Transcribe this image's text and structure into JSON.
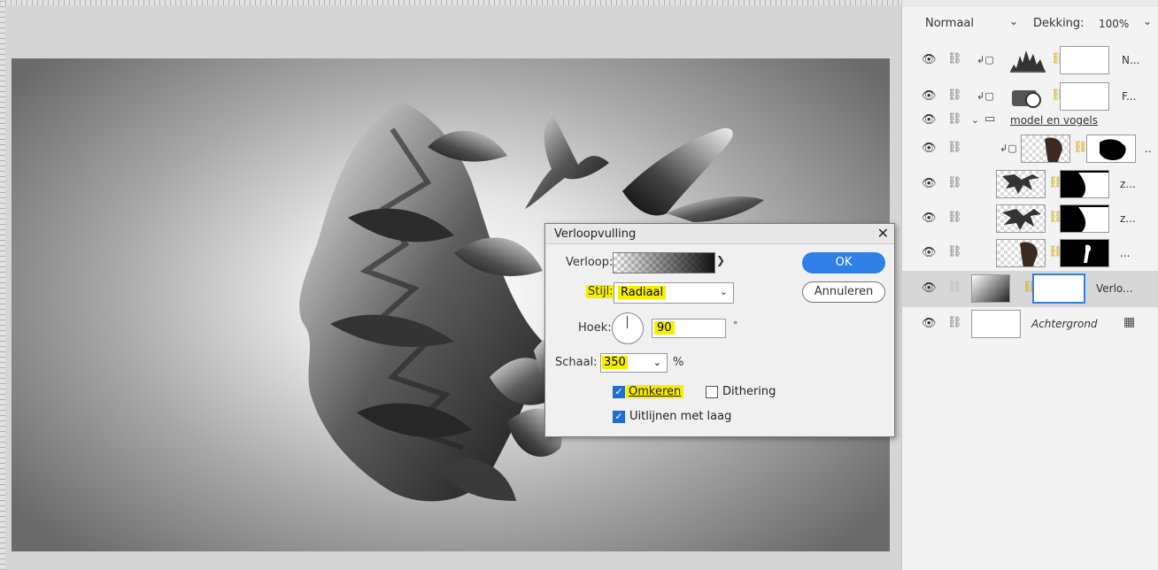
{
  "dialog": {
    "title": "Verloopvulling",
    "close_glyph": "✕",
    "gradient_label": "Verloop:",
    "style_label": "Stijl:",
    "style_value": "Radiaal",
    "angle_label": "Hoek:",
    "angle_value": "90",
    "angle_unit": "°",
    "scale_label": "Schaal:",
    "scale_value": "350",
    "scale_unit": "%",
    "reverse_label": "Omkeren",
    "reverse_checked": true,
    "dither_label": "Dithering",
    "dither_checked": false,
    "align_label": "Uitlijnen met laag",
    "align_checked": true,
    "ok_label": "OK",
    "cancel_label": "Annuleren",
    "highlight_color": "#f7ee00",
    "accent_color": "#2f7fe6"
  },
  "layers": {
    "blend_mode": "Normaal",
    "opacity_label": "Dekking:",
    "opacity_value": "100%",
    "rows": [
      {
        "name": "N...",
        "icon": "histogram-levels-icon"
      },
      {
        "name": "F...",
        "icon": "camera-filter-icon"
      },
      {
        "name": "model en vogels",
        "icon": "folder-group-icon"
      },
      {
        "name": "..",
        "icon": "portrait-thumbnail"
      },
      {
        "name": "z...",
        "icon": "birds-thumbnail"
      },
      {
        "name": "z...",
        "icon": "birds-thumbnail"
      },
      {
        "name": "...",
        "icon": "portrait-thumbnail"
      },
      {
        "name": "Verlo...",
        "icon": "gradient-thumbnail"
      },
      {
        "name": "Achtergrond",
        "icon": "lock-icon"
      }
    ]
  }
}
